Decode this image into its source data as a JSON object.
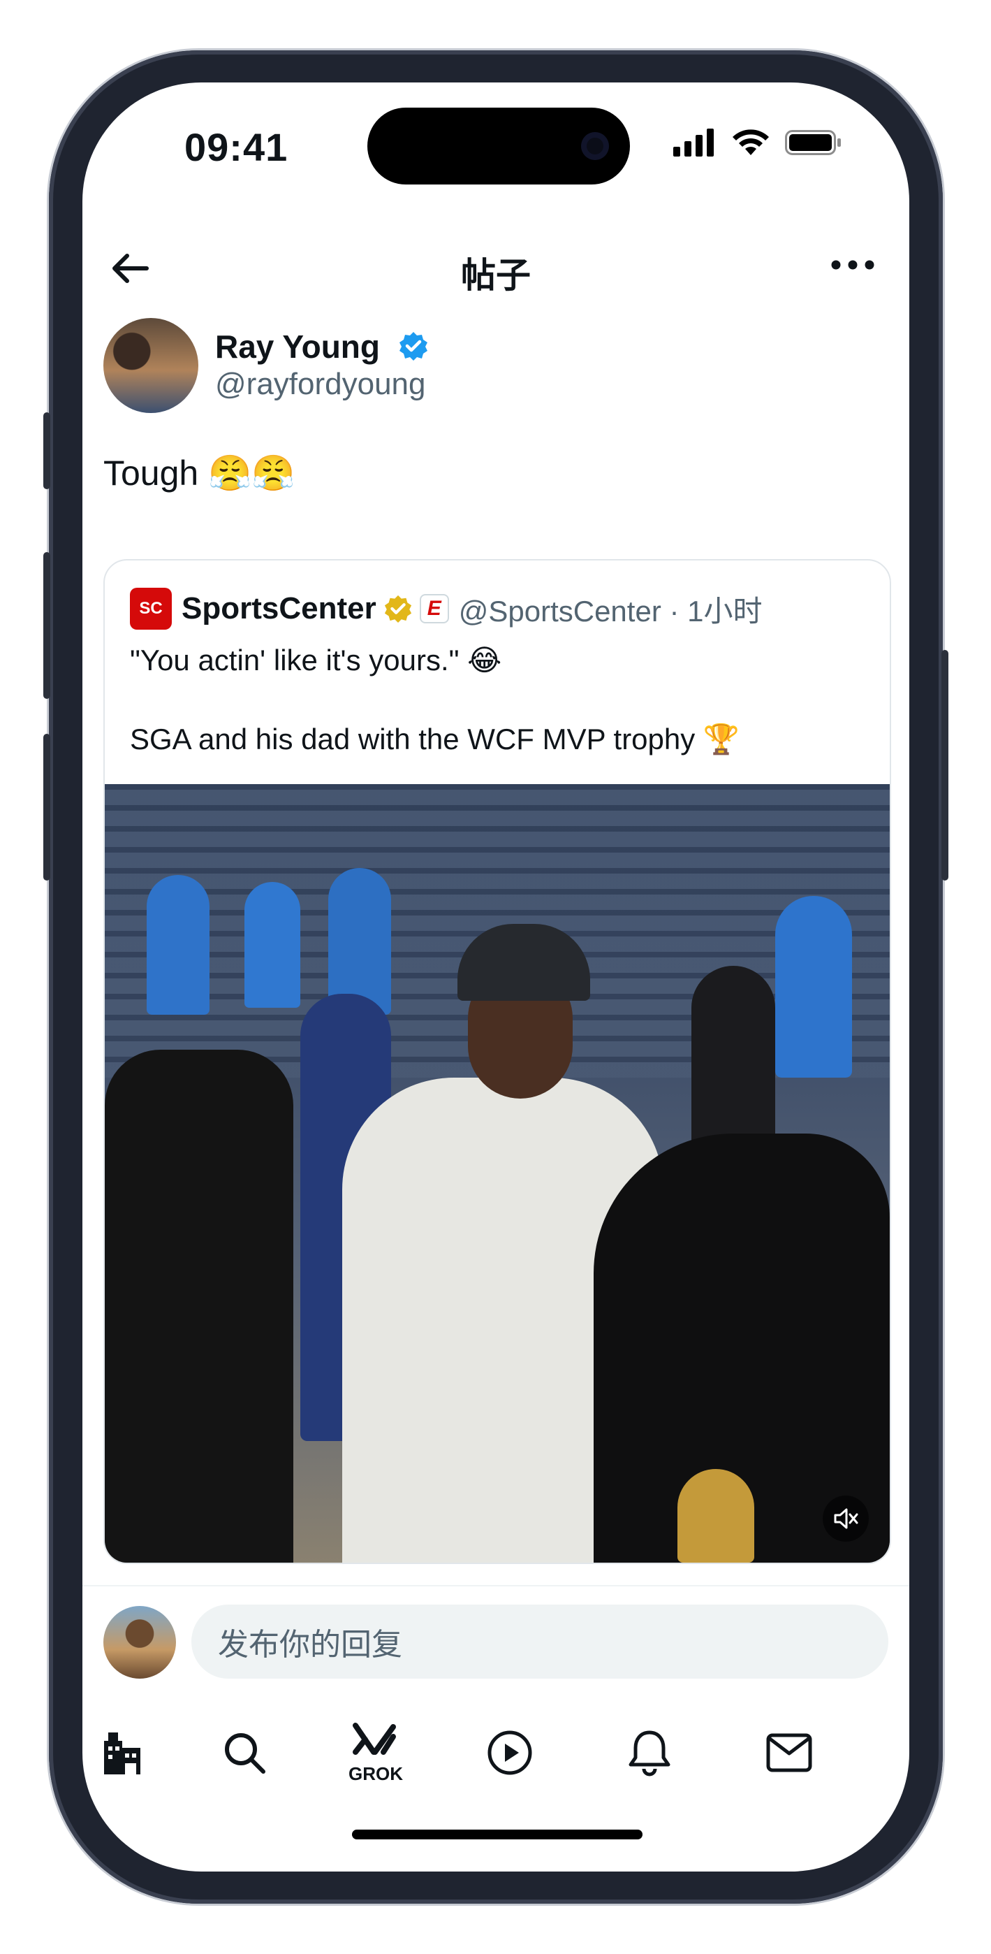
{
  "status_bar": {
    "time": "09:41"
  },
  "nav": {
    "title": "帖子"
  },
  "post": {
    "author_name": "Ray Young",
    "author_handle": "@rayfordyoung",
    "text": "Tough",
    "emoji": "😤😤"
  },
  "quote": {
    "logo_text": "SC",
    "name": "SportsCenter",
    "espn_letter": "E",
    "handle_time": "@SportsCenter · 1小时",
    "line1": "\"You actin' like it's yours.\" 😂",
    "line2": "SGA and his dad with the WCF MVP trophy 🏆"
  },
  "reply": {
    "placeholder": "发布你的回复"
  },
  "tabs": [
    {
      "name": "home",
      "label": ""
    },
    {
      "name": "search",
      "label": ""
    },
    {
      "name": "grok",
      "label": "GROK"
    },
    {
      "name": "video",
      "label": ""
    },
    {
      "name": "notifications",
      "label": ""
    },
    {
      "name": "messages",
      "label": ""
    }
  ],
  "icons": {
    "back": "arrow-left-icon",
    "more": "more-icon",
    "verified": "verified-badge-icon",
    "mute": "muted-speaker-icon"
  },
  "colors": {
    "verified_blue": "#1d9bf0",
    "verified_gold": "#e2b719",
    "espn_red": "#d50a0a",
    "secondary_text": "#536471"
  }
}
